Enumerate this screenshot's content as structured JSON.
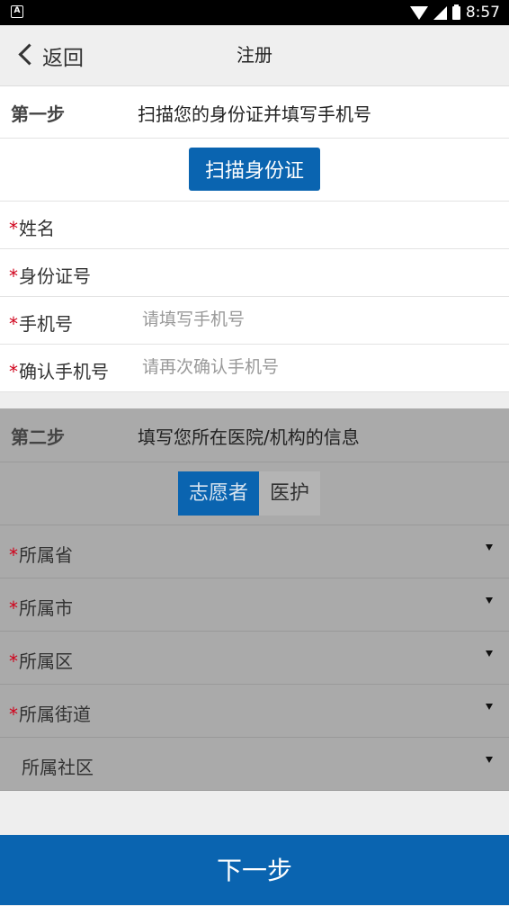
{
  "status_bar": {
    "time": "8:57",
    "notification_icon": "A"
  },
  "header": {
    "back_label": "返回",
    "title": "注册"
  },
  "step1": {
    "label": "第一步",
    "description": "扫描您的身份证并填写手机号",
    "scan_button": "扫描身份证",
    "fields": [
      {
        "required": "*",
        "label": "姓名",
        "value": "",
        "placeholder": ""
      },
      {
        "required": "*",
        "label": "身份证号",
        "value": "",
        "placeholder": ""
      },
      {
        "required": "*",
        "label": "手机号",
        "value": "",
        "placeholder": "请填写手机号"
      },
      {
        "required": "*",
        "label": "确认手机号",
        "value": "",
        "placeholder": "请再次确认手机号"
      }
    ]
  },
  "step2": {
    "label": "第二步",
    "description": "填写您所在医院/机构的信息",
    "role_options": [
      "志愿者",
      "医护"
    ],
    "selected_role": "志愿者",
    "selects": [
      {
        "required": "*",
        "label": "所属省"
      },
      {
        "required": "*",
        "label": "所属市"
      },
      {
        "required": "*",
        "label": "所属区"
      },
      {
        "required": "*",
        "label": "所属街道"
      },
      {
        "required": "",
        "label": "所属社区"
      }
    ]
  },
  "footer": {
    "next_label": "下一步"
  },
  "colors": {
    "primary": "#0a64b0",
    "required": "#d0021b",
    "overlay_gray": "#aaaaaa"
  }
}
